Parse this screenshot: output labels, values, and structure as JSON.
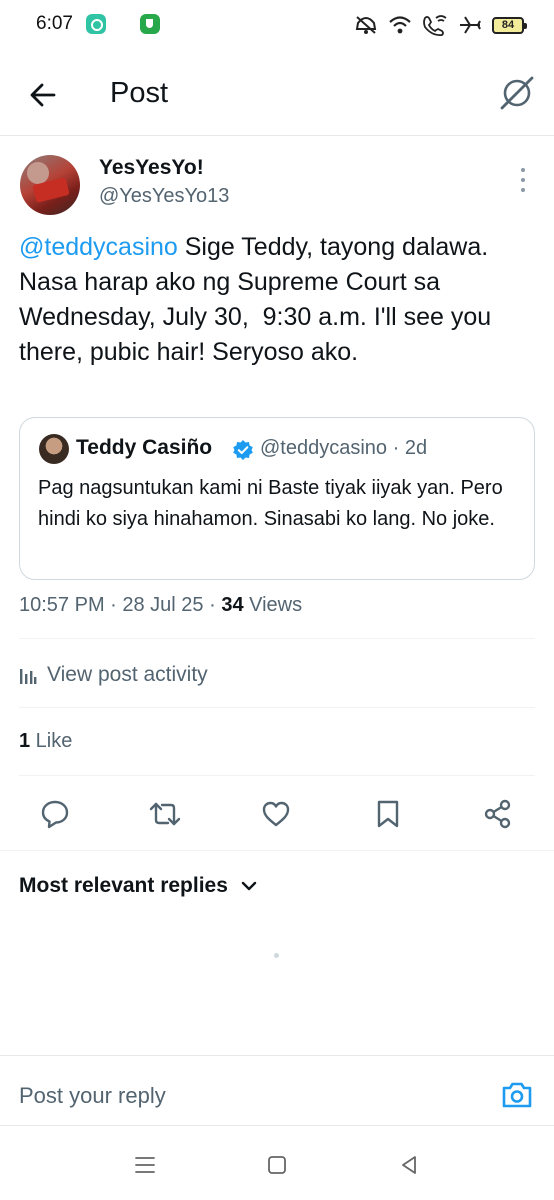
{
  "status_bar": {
    "time": "6:07",
    "battery": "84",
    "icons": [
      "chat-app-icon",
      "shield-app-icon",
      "mute-icon",
      "wifi-icon",
      "wifi-call-icon",
      "airplane-icon",
      "battery-icon"
    ]
  },
  "header": {
    "title": "Post"
  },
  "tweet": {
    "display_name": "YesYesYo!",
    "handle": "@YesYesYo13",
    "mention": "@teddycasino",
    "body": " Sige Teddy, tayong dalawa. Nasa harap ako ng Supreme Court sa Wednesday, July 30,  9:30 a.m. I'll see you there, pubic hair! Seryoso ako.",
    "timestamp": "10:57 PM · 28 Jul 25 · ",
    "views_count": "34",
    "views_label": " Views"
  },
  "quote": {
    "display_name": "Teddy Casiño",
    "meta": "@teddycasino · 2d",
    "text": "Pag nagsuntukan kami ni Baste tiyak iiyak yan. Pero hindi ko siya hinahamon. Sinasabi ko lang. No joke."
  },
  "activity": {
    "label": "View post activity"
  },
  "likes": {
    "count": "1",
    "label": " Like"
  },
  "actions": [
    "reply-icon",
    "repost-icon",
    "like-icon",
    "bookmark-icon",
    "share-icon"
  ],
  "replies": {
    "sort_label": "Most relevant replies"
  },
  "reply_bar": {
    "placeholder": "Post your reply"
  },
  "colors": {
    "accent": "#1d9bf0",
    "text_primary": "#0f1419",
    "text_secondary": "#536471",
    "border": "#cfd9de"
  }
}
